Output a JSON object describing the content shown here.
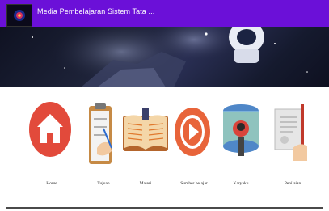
{
  "app": {
    "title": "Media Pembelajaran Sistem Tata ..."
  },
  "menu": [
    {
      "label": "Home",
      "icon": "home-icon"
    },
    {
      "label": "Tujuan",
      "icon": "clipboard-icon"
    },
    {
      "label": "Materi",
      "icon": "book-icon"
    },
    {
      "label": "Sumber belajar",
      "icon": "play-icon"
    },
    {
      "label": "Karyaku",
      "icon": "astronaut-icon"
    },
    {
      "label": "Penilaian",
      "icon": "assessment-icon"
    }
  ],
  "colors": {
    "appbar": "#6b10d8",
    "home": "#e24a3b",
    "play": "#e8643a"
  }
}
